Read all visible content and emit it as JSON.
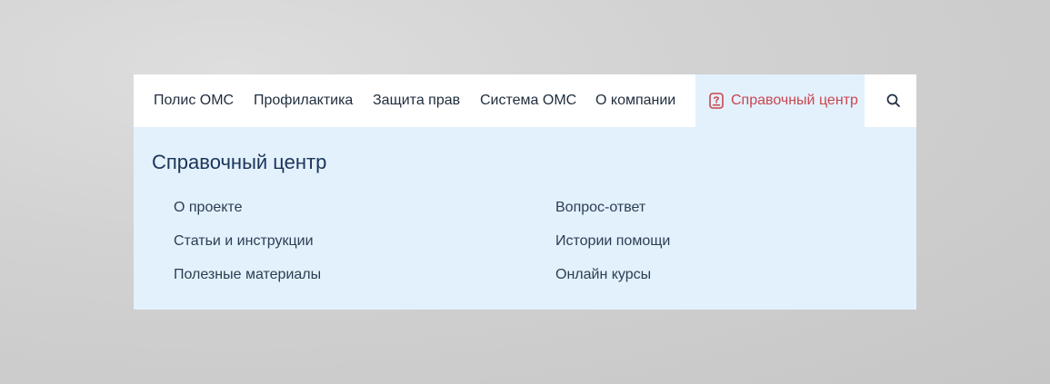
{
  "nav": {
    "items": [
      "Полис ОМС",
      "Профилактика",
      "Защита прав",
      "Система ОМС",
      "О компании"
    ],
    "active": {
      "label": "Справочный центр",
      "icon": "help-center-icon"
    },
    "search_icon": "search-icon"
  },
  "dropdown": {
    "title": "Справочный центр",
    "left_links": [
      "О проекте",
      "Статьи и инструкции",
      "Полезные материалы"
    ],
    "right_links": [
      "Вопрос-ответ",
      "Истории помощи",
      "Онлайн курсы"
    ]
  },
  "colors": {
    "accent": "#c9464f",
    "panel_bg": "#e3f1fd",
    "title": "#1b3559",
    "text": "#1f2d3d"
  }
}
